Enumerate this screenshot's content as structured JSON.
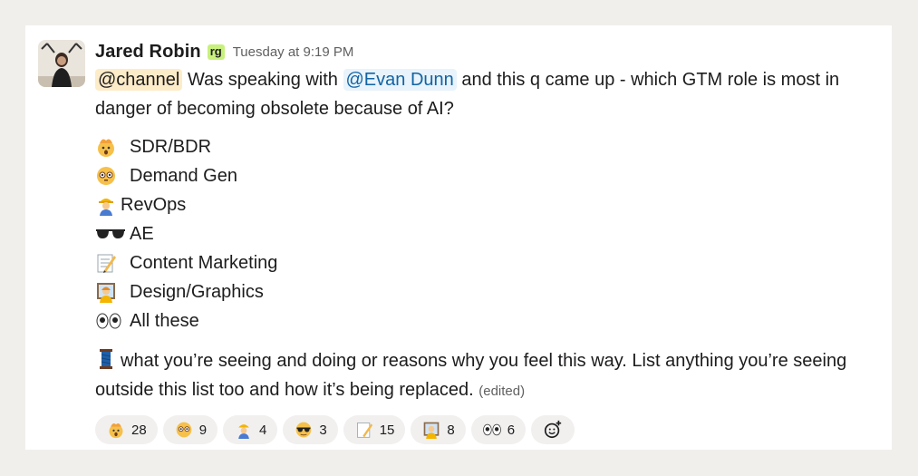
{
  "message": {
    "author": "Jared Robin",
    "badge": "rg",
    "timestamp": "Tuesday at 9:19 PM",
    "mention_channel": "@channel",
    "text_a": "Was speaking with",
    "mention_user": "@Evan Dunn",
    "text_b": "and this q came up - which GTM role is most in danger of becoming obsolete because of AI?",
    "options": [
      {
        "label": "SDR/BDR",
        "icon": "exploding-head-icon"
      },
      {
        "label": "Demand Gen",
        "icon": "flushed-face-icon"
      },
      {
        "label": "RevOps",
        "icon": "construction-worker-icon"
      },
      {
        "label": "AE",
        "icon": "sunglasses-icon"
      },
      {
        "label": "Content Marketing",
        "icon": "memo-icon"
      },
      {
        "label": "Design/Graphics",
        "icon": "artist-icon"
      },
      {
        "label": "All these",
        "icon": "eyes-icon"
      }
    ],
    "thread_icon": "thread-icon",
    "outro": "what you’re seeing and doing or reasons why you feel this way. List anything you’re seeing outside this list too and how it’s being replaced.",
    "edited": "(edited)"
  },
  "reactions": [
    {
      "icon": "exploding-head-icon",
      "count": "28"
    },
    {
      "icon": "flushed-face-icon",
      "count": "9"
    },
    {
      "icon": "construction-worker-icon",
      "count": "4"
    },
    {
      "icon": "sunglasses-icon",
      "count": "3"
    },
    {
      "icon": "memo-icon",
      "count": "15"
    },
    {
      "icon": "artist-icon",
      "count": "8"
    },
    {
      "icon": "eyes-icon",
      "count": "6"
    }
  ],
  "add_reaction_icon": "add-reaction-icon",
  "colors": {
    "channel_mention_bg": "#fdecc8",
    "user_mention": "#1264a3",
    "badge": "#c8f07d"
  }
}
